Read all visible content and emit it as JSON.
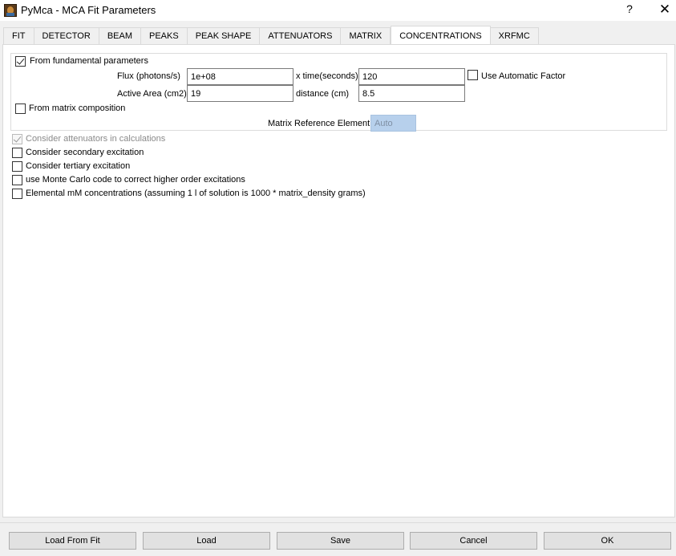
{
  "window": {
    "title": "PyMca - MCA Fit Parameters",
    "help_label": "?",
    "close_label": "✕"
  },
  "tabs": [
    {
      "label": "FIT"
    },
    {
      "label": "DETECTOR"
    },
    {
      "label": "BEAM"
    },
    {
      "label": "PEAKS"
    },
    {
      "label": "PEAK SHAPE"
    },
    {
      "label": "ATTENUATORS"
    },
    {
      "label": "MATRIX"
    },
    {
      "label": "CONCENTRATIONS"
    },
    {
      "label": "XRFMC"
    }
  ],
  "active_tab": "CONCENTRATIONS",
  "fundamental": {
    "checkbox_label": "From fundamental parameters",
    "checked": true,
    "flux_label": "Flux (photons/s)",
    "flux_value": "1e+08",
    "time_label": "x time(seconds)",
    "time_value": "120",
    "auto_factor_label": "Use Automatic Factor",
    "auto_factor_checked": false,
    "area_label": "Active Area (cm2)",
    "area_value": "19",
    "distance_label": "distance (cm)",
    "distance_value": "8.5"
  },
  "matrix": {
    "checkbox_label": "From matrix composition",
    "checked": false,
    "ref_label": "Matrix Reference Element:",
    "ref_value": "Auto"
  },
  "options": [
    {
      "label": "Consider attenuators in calculations",
      "checked": true,
      "disabled": true
    },
    {
      "label": "Consider secondary excitation",
      "checked": false,
      "disabled": false
    },
    {
      "label": "Consider tertiary excitation",
      "checked": false,
      "disabled": false
    },
    {
      "label": "use Monte Carlo code to correct higher order excitations",
      "checked": false,
      "disabled": false
    },
    {
      "label": "Elemental mM concentrations (assuming 1 l of solution is 1000 * matrix_density grams)",
      "checked": false,
      "disabled": false
    }
  ],
  "buttons": {
    "load_from_fit": "Load From Fit",
    "load": "Load",
    "save": "Save",
    "cancel": "Cancel",
    "ok": "OK"
  }
}
